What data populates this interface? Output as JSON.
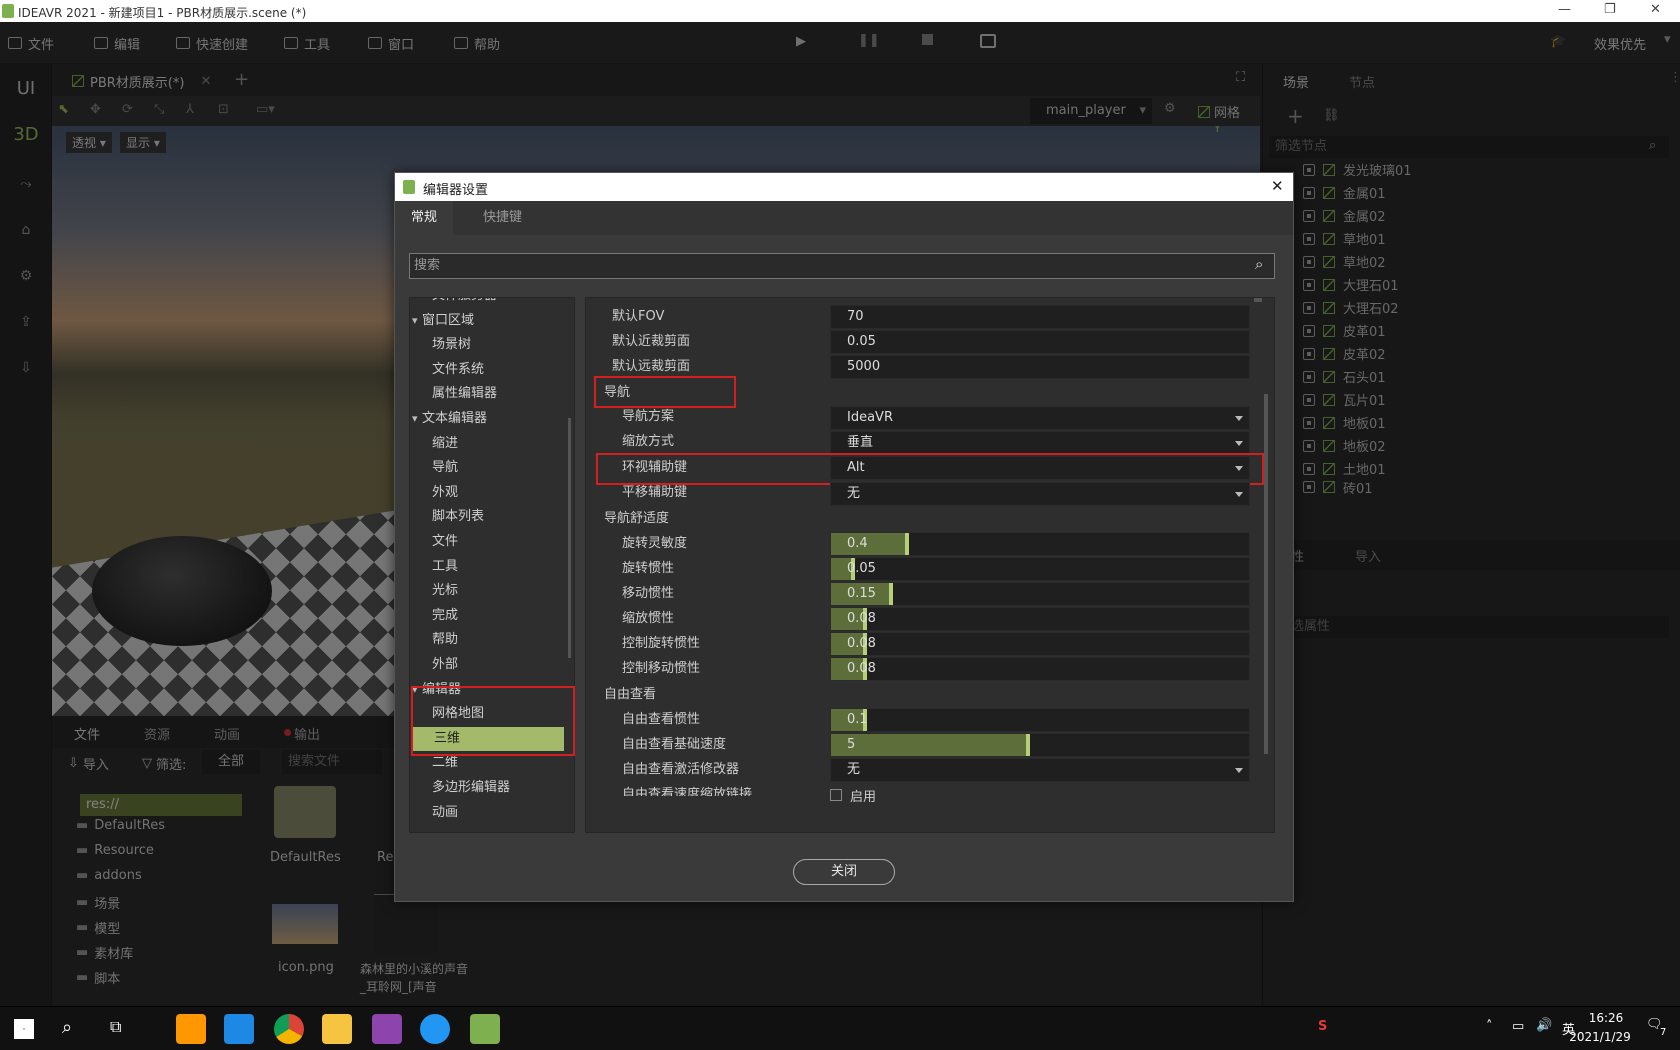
{
  "app": {
    "title": "IDEAVR 2021 - 新建项目1 - PBR材质展示.scene (*)",
    "quality": "效果优先"
  },
  "menu": [
    "文件",
    "编辑",
    "快速创建",
    "工具",
    "窗口",
    "帮助"
  ],
  "left_strip": {
    "ui": "UI",
    "three_d": "3D"
  },
  "viewport": {
    "tab": "PBR材质展示(*)",
    "camera": "main_player",
    "grid": "网格",
    "view_mode": "透视",
    "display": "显示",
    "gizmo_y": "Y"
  },
  "bottom": {
    "tabs": [
      "文件",
      "资源",
      "动画",
      "输出"
    ],
    "import": "导入",
    "filter": "筛选:",
    "filter_value": "全部",
    "search_placeholder": "搜索文件",
    "root": "res://",
    "folders": [
      "DefaultRes",
      "Resource",
      "addons",
      "场景",
      "模型",
      "素材库",
      "脚本"
    ],
    "files": [
      "DefaultRes",
      "icon.png",
      "森林里的小溪的声音_耳聆网_[声音"
    ],
    "partial_file": "Re"
  },
  "right_panel": {
    "tabs": [
      "场景",
      "节点"
    ],
    "filter_placeholder": "筛选节点",
    "nodes": [
      "发光玻璃01",
      "金属01",
      "金属02",
      "草地01",
      "草地02",
      "大理石01",
      "大理石02",
      "皮革01",
      "皮革02",
      "石头01",
      "瓦片01",
      "地板01",
      "地板02",
      "土地01",
      "砖01"
    ],
    "tabs2": [
      "性",
      "导入"
    ],
    "prop_filter": "选属性"
  },
  "dialog": {
    "title": "编辑器设置",
    "tabs": [
      "常规",
      "快捷键"
    ],
    "search_placeholder": "搜索",
    "tree": [
      {
        "label": "文件服务器",
        "level": 1
      },
      {
        "label": "窗口区域",
        "level": 0
      },
      {
        "label": "场景树",
        "level": 1
      },
      {
        "label": "文件系统",
        "level": 1
      },
      {
        "label": "属性编辑器",
        "level": 1
      },
      {
        "label": "文本编辑器",
        "level": 0
      },
      {
        "label": "缩进",
        "level": 1
      },
      {
        "label": "导航",
        "level": 1
      },
      {
        "label": "外观",
        "level": 1
      },
      {
        "label": "脚本列表",
        "level": 1
      },
      {
        "label": "文件",
        "level": 1
      },
      {
        "label": "工具",
        "level": 1
      },
      {
        "label": "光标",
        "level": 1
      },
      {
        "label": "完成",
        "level": 1
      },
      {
        "label": "帮助",
        "level": 1
      },
      {
        "label": "外部",
        "level": 1
      },
      {
        "label": "编辑器",
        "level": 0
      },
      {
        "label": "网格地图",
        "level": 1
      },
      {
        "label": "三维",
        "level": 1,
        "selected": true
      },
      {
        "label": "二维",
        "level": 1
      },
      {
        "label": "多边形编辑器",
        "level": 1
      },
      {
        "label": "动画",
        "level": 1
      }
    ],
    "props": {
      "fov_label": "默认FOV",
      "fov": "70",
      "near_label": "默认近裁剪面",
      "near": "0.05",
      "far_label": "默认远裁剪面",
      "far": "5000",
      "nav_section": "导航",
      "nav_scheme_label": "导航方案",
      "nav_scheme": "IdeaVR",
      "zoom_label": "缩放方式",
      "zoom": "垂直",
      "orbit_label": "环视辅助键",
      "orbit": "Alt",
      "pan_label": "平移辅助键",
      "pan": "无",
      "comfort_section": "导航舒适度",
      "rot_sens_label": "旋转灵敏度",
      "rot_sens": "0.4",
      "rot_sens_fill": 0.18,
      "rot_inertia_label": "旋转惯性",
      "rot_inertia": "0.05",
      "rot_inertia_fill": 0.05,
      "move_inertia_label": "移动惯性",
      "move_inertia": "0.15",
      "move_inertia_fill": 0.14,
      "zoom_inertia_label": "缩放惯性",
      "zoom_inertia": "0.08",
      "zoom_inertia_fill": 0.08,
      "ctrl_rot_label": "控制旋转惯性",
      "ctrl_rot": "0.08",
      "ctrl_rot_fill": 0.08,
      "ctrl_move_label": "控制移动惯性",
      "ctrl_move": "0.08",
      "ctrl_move_fill": 0.08,
      "free_section": "自由查看",
      "free_inertia_label": "自由查看惯性",
      "free_inertia": "0.1",
      "free_inertia_fill": 0.08,
      "free_speed_label": "自由查看基础速度",
      "free_speed": "5",
      "free_speed_fill": 0.47,
      "free_mod_label": "自由查看激活修改器",
      "free_mod": "无",
      "free_link_label": "自由查看速度缩放链接",
      "free_link": "启用"
    },
    "close": "关闭"
  },
  "taskbar": {
    "time": "16:26",
    "date": "2021/1/29",
    "notif": "7",
    "sogou": "S"
  }
}
